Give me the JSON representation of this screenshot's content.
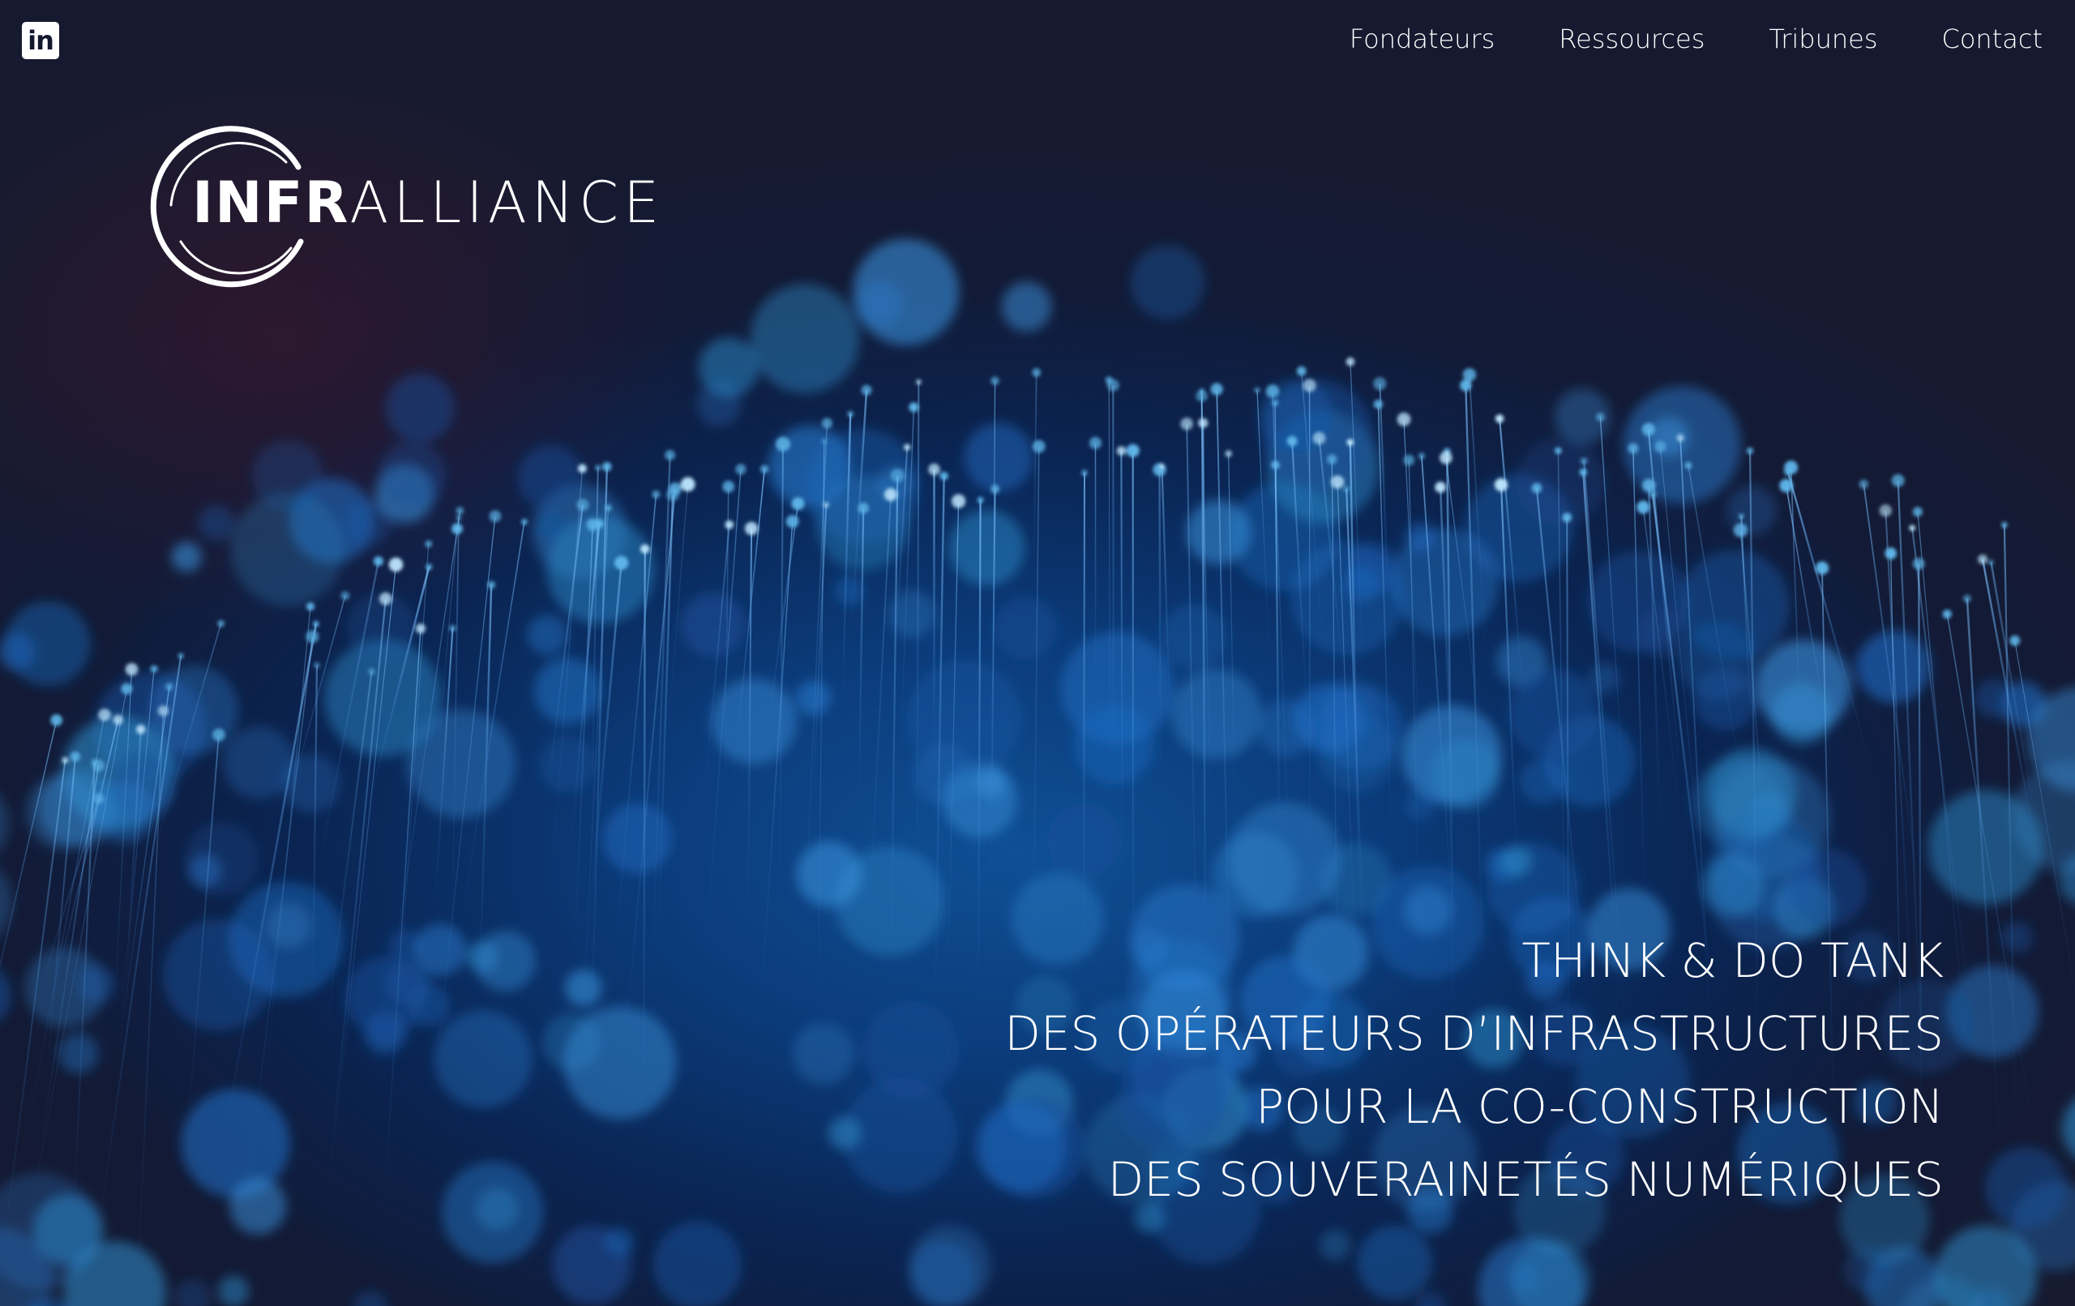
{
  "header": {
    "social": {
      "linkedin_glyph": "in",
      "icon": "linkedin-icon"
    },
    "nav": [
      {
        "label": "Fondateurs"
      },
      {
        "label": "Ressources"
      },
      {
        "label": "Tribunes"
      },
      {
        "label": "Contact"
      }
    ]
  },
  "logo": {
    "part1": "INFR",
    "part2": "ALLIANCE"
  },
  "hero": {
    "tagline": [
      "THINK & DO TANK",
      "DES OPÉRATEURS D’INFRASTRUCTURES",
      "POUR LA CO-CONSTRUCTION",
      "DES SOUVERAINETÉS NUMÉRIQUES"
    ],
    "background": "fiber-optic-bokeh-image"
  },
  "colors": {
    "background": "#14182e",
    "accent_blue": "#1f6fc7",
    "text": "#ffffff"
  }
}
